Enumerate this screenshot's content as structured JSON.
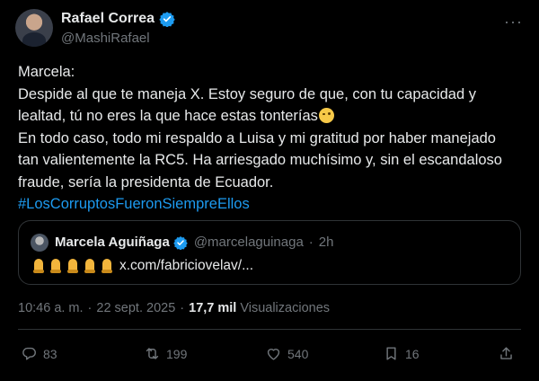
{
  "author": {
    "name": "Rafael Correa",
    "handle": "@MashiRafael"
  },
  "more_label": "···",
  "tweet": {
    "lines": [
      "Marcela:",
      "Despide al que te maneja X. Estoy seguro de que, con tu capacidad y",
      "lealtad, tú no eres la que hace estas tonterías",
      "En todo caso, todo mi respaldo a Luisa y mi gratitud por haber manejado",
      "tan valientemente la RC5. Ha arriesgado muchísimo y, sin el escandaloso",
      "fraude, sería la presidenta de Ecuador."
    ],
    "hashtag": "#LosCorruptosFueronSiempreEllos"
  },
  "quote": {
    "name": "Marcela Aguiñaga",
    "handle": "@marcelaguinaga",
    "separator": "·",
    "time": "2h",
    "link": "x.com/fabriciovelav/..."
  },
  "meta": {
    "time": "10:46 a. m.",
    "separator1": "·",
    "date": "22 sept. 2025",
    "separator2": "·",
    "views": "17,7 mil",
    "views_label": "Visualizaciones"
  },
  "actions": {
    "replies": "83",
    "reposts": "199",
    "likes": "540",
    "bookmarks": "16"
  },
  "colors": {
    "background": "#000000",
    "text": "#e7e9ea",
    "muted": "#71767b",
    "accent": "#1d9bf0",
    "border": "#2f3336"
  }
}
